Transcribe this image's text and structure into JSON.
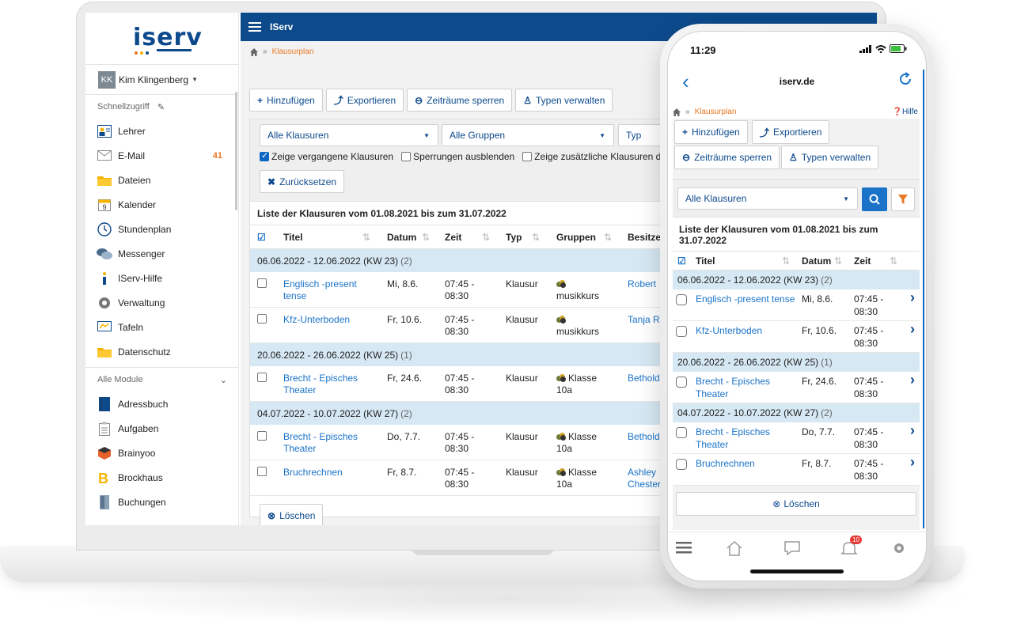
{
  "laptop": {
    "sidebar": {
      "user": {
        "initials": "KK",
        "name": "Kim Klingenberg"
      },
      "quick_access_label": "Schnellzugriff",
      "items": [
        {
          "label": "Lehrer",
          "icon": "teacher-icon"
        },
        {
          "label": "E-Mail",
          "icon": "mail-icon",
          "badge": "41"
        },
        {
          "label": "Dateien",
          "icon": "folder-icon"
        },
        {
          "label": "Kalender",
          "icon": "calendar-icon",
          "icon_text": "9"
        },
        {
          "label": "Stundenplan",
          "icon": "clock-icon"
        },
        {
          "label": "Messenger",
          "icon": "chat-icon"
        },
        {
          "label": "IServ-Hilfe",
          "icon": "help-icon"
        },
        {
          "label": "Verwaltung",
          "icon": "gear-icon"
        },
        {
          "label": "Tafeln",
          "icon": "board-icon"
        },
        {
          "label": "Datenschutz",
          "icon": "folder-icon"
        }
      ],
      "all_modules_label": "Alle Module",
      "modules": [
        {
          "label": "Adressbuch",
          "icon": "book-icon"
        },
        {
          "label": "Aufgaben",
          "icon": "clipboard-icon"
        },
        {
          "label": "Brainyoo",
          "icon": "cube-icon"
        },
        {
          "label": "Brockhaus",
          "icon": "brockhaus-icon"
        },
        {
          "label": "Buchungen",
          "icon": "door-icon"
        }
      ]
    },
    "topbar": {
      "title": "IServ"
    },
    "breadcrumb": {
      "separator": "»",
      "current": "Klausurplan"
    },
    "toolbar": {
      "add": "Hinzufügen",
      "export": "Exportieren",
      "lock": "Zeiträume sperren",
      "types": "Typen verwalten"
    },
    "filters": {
      "exams": "Alle Klausuren",
      "groups": "Alle Gruppen",
      "type": "Typ",
      "show_past": "Zeige vergangene Klausuren",
      "hide_locks": "Sperrungen ausblenden",
      "show_additional": "Zeige zusätzliche Klausuren der Gr",
      "reset": "Zurücksetzen"
    },
    "list_title": "Liste der Klausuren vom 01.08.2021 bis zum 31.07.2022",
    "columns": {
      "title": "Titel",
      "date": "Datum",
      "time": "Zeit",
      "type": "Typ",
      "groups": "Gruppen",
      "owner": "Besitze"
    },
    "groups": [
      {
        "label": "06.06.2022 - 12.06.2022 (KW 23)",
        "count": "(2)",
        "rows": [
          {
            "title_1": "Englisch -present",
            "title_2": "tense",
            "date": "Mi, 8.6.",
            "time_1": "07:45 -",
            "time_2": "08:30",
            "type": "Klausur",
            "group_1": "",
            "group_2": "musikkurs",
            "owner_1": "Robert",
            "owner_2": ""
          },
          {
            "title_1": "Kfz-Unterboden",
            "title_2": "",
            "date": "Fr, 10.6.",
            "time_1": "07:45 -",
            "time_2": "08:30",
            "type": "Klausur",
            "group_1": "",
            "group_2": "musikkurs",
            "owner_1": "Tanja R",
            "owner_2": ""
          }
        ]
      },
      {
        "label": "20.06.2022 - 26.06.2022 (KW 25)",
        "count": "(1)",
        "rows": [
          {
            "title_1": "Brecht - Episches",
            "title_2": "Theater",
            "date": "Fr, 24.6.",
            "time_1": "07:45 -",
            "time_2": "08:30",
            "type": "Klausur",
            "group_1": "Klasse",
            "group_2": "10a",
            "owner_1": "Bethold",
            "owner_2": ""
          }
        ]
      },
      {
        "label": "04.07.2022 - 10.07.2022 (KW 27)",
        "count": "(2)",
        "rows": [
          {
            "title_1": "Brecht - Episches",
            "title_2": "Theater",
            "date": "Do, 7.7.",
            "time_1": "07:45 -",
            "time_2": "08:30",
            "type": "Klausur",
            "group_1": "Klasse",
            "group_2": "10a",
            "owner_1": "Bethold",
            "owner_2": ""
          },
          {
            "title_1": "Bruchrechnen",
            "title_2": "",
            "date": "Fr, 8.7.",
            "time_1": "07:45 -",
            "time_2": "08:30",
            "type": "Klausur",
            "group_1": "Klasse",
            "group_2": "10a",
            "owner_1": "Ashley",
            "owner_2": "Chester"
          }
        ]
      }
    ],
    "delete": "Löschen"
  },
  "phone": {
    "time": "11:29",
    "url": "iserv.de",
    "breadcrumb": "Klausurplan",
    "help": "Hilfe",
    "buttons": {
      "add": "Hinzufügen",
      "export": "Exportieren",
      "lock": "Zeiträume sperren",
      "types": "Typen verwalten"
    },
    "filter": "Alle Klausuren",
    "list_title": "Liste der Klausuren vom 01.08.2021 bis zum 31.07.2022",
    "columns": {
      "title": "Titel",
      "date": "Datum",
      "time": "Zeit"
    },
    "groups": [
      {
        "label": "06.06.2022 - 12.06.2022 (KW 23)",
        "count": "(2)",
        "rows": [
          {
            "title_1": "Englisch -present tense",
            "title_2": "",
            "date": "Mi, 8.6.",
            "time_1": "07:45 -",
            "time_2": "08:30"
          },
          {
            "title_1": "Kfz-Unterboden",
            "title_2": "",
            "date": "Fr, 10.6.",
            "time_1": "07:45 -",
            "time_2": "08:30"
          }
        ]
      },
      {
        "label": "20.06.2022 - 26.06.2022 (KW 25)",
        "count": "(1)",
        "rows": [
          {
            "title_1": "Brecht - Episches",
            "title_2": "Theater",
            "date": "Fr, 24.6.",
            "time_1": "07:45 -",
            "time_2": "08:30"
          }
        ]
      },
      {
        "label": "04.07.2022 - 10.07.2022 (KW 27)",
        "count": "(2)",
        "rows": [
          {
            "title_1": "Brecht - Episches",
            "title_2": "Theater",
            "date": "Do, 7.7.",
            "time_1": "07:45 -",
            "time_2": "08:30"
          },
          {
            "title_1": "Bruchrechnen",
            "title_2": "",
            "date": "Fr, 8.7.",
            "time_1": "07:45 -",
            "time_2": "08:30"
          }
        ]
      }
    ],
    "delete": "Löschen",
    "notification_count": "10"
  },
  "colors": {
    "primary": "#0d4a8c",
    "link": "#1a73c8",
    "accent": "#e87722",
    "group_row": "#d6e8f3"
  }
}
